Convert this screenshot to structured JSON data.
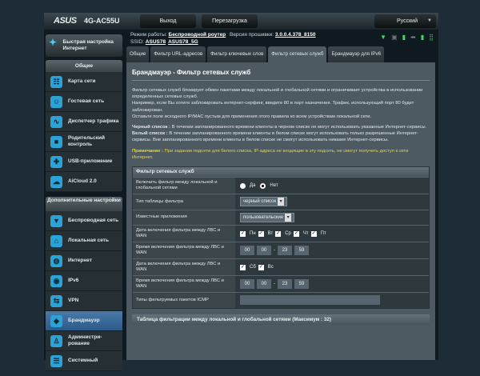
{
  "header": {
    "brand": "ASUS",
    "model": "4G-AC55U",
    "logout": "Выход",
    "reboot": "Перезагрузка",
    "language": "Русский"
  },
  "info": {
    "mode_label": "Режим работы:",
    "mode": "Беспроводной роутер",
    "fw_label": "Версия прошивки:",
    "fw": "3.0.0.4.378_8150",
    "ssid_label": "SSID:",
    "ssid1": "ASUS78",
    "ssid2": "ASUS78_5G"
  },
  "sidebar": {
    "qis": "Быстрая настройка Интернет",
    "general_title": "Общие",
    "general": [
      {
        "label": "Карта сети",
        "icon": "network-map-icon"
      },
      {
        "label": "Гостевая сеть",
        "icon": "guest-network-icon"
      },
      {
        "label": "Диспетчер трафика",
        "icon": "traffic-manager-icon"
      },
      {
        "label": "Родительский контроль",
        "icon": "lock-icon"
      },
      {
        "label": "USB-приложение",
        "icon": "puzzle-icon"
      },
      {
        "label": "AiCloud 2.0",
        "icon": "cloud-icon"
      }
    ],
    "advanced_title": "Дополнительные настройки",
    "advanced": [
      {
        "label": "Беспроводная сеть",
        "icon": "wifi-icon"
      },
      {
        "label": "Локальная сеть",
        "icon": "home-icon"
      },
      {
        "label": "Интернет",
        "icon": "globe-icon"
      },
      {
        "label": "IPv6",
        "icon": "ipv6-icon"
      },
      {
        "label": "VPN",
        "icon": "vpn-icon"
      },
      {
        "label": "Брандмауэр",
        "icon": "shield-icon"
      },
      {
        "label": "Администри-рование",
        "icon": "admin-icon"
      },
      {
        "label": "Системный",
        "icon": "log-icon"
      }
    ]
  },
  "tabs": [
    "Общие",
    "Фильтр URL-адресов",
    "Фильтр ключевых слов",
    "Фильтр сетевых служб",
    "Брандмауэр для IPv6"
  ],
  "content": {
    "title": "Брандмауэр - Фильтр сетевых служб",
    "p1": "Фильтр сетевых служб блокирует обмен пакетами между локальной и глобальной сетями и ограничивает устройства в использовании определенных сетевых служб.",
    "p2": "Например, если Вы хотите заблокировать интернет-серфинг, введите 80 в порт назначения. Трафик, использующий порт 80 будет заблокирован.",
    "p3": "Оставьте поле исходного IP/MAC пустым для применения этого правила ко всем устройствам локальной сети.",
    "black_label": "Черный список :",
    "black": " В течении запланированного времени клиенты в черном списке не могут использовать указанные Интернет-сервисы.",
    "white_label": "Белый список :",
    "white": " В течении запланированного времени клиенты в белом списке могут использовать только разрешенные Интернет-сервисы. Вне запланированного времени клиенты в белом списке не смогут использовать никакие Интернет-сервисы.",
    "note_label": "Примечание :",
    "note": " При задании подсети для белого списка, IP-адреса не входящие в эту подсеть, не смогут получить доступ к сети Интернет."
  },
  "table": {
    "title": "Фильтр сетевых служб",
    "enable_label": "Включить фильтр между локальной и глобальной сетями",
    "yes": "Да",
    "no": "Нет",
    "type_label": "Тип таблицы фильтра",
    "type_value": "черный список",
    "apps_label": "Известные приложения",
    "apps_value": "пользовательские",
    "date1_label": "Дата включения фильтра между ЛВС и WAN",
    "days1": [
      "Пн",
      "Вт",
      "Ср",
      "Чт",
      "Пт"
    ],
    "time1_label": "Время включения фильтра между ЛВС и WAN",
    "time1": [
      "00",
      "00",
      "23",
      "59"
    ],
    "date2_label": "Дата включения фильтра между ЛВС и WAN",
    "days2": [
      "Сб",
      "Вс"
    ],
    "time2_label": "Время включения фильтра между ЛВС и WAN",
    "time2": [
      "00",
      "00",
      "23",
      "59"
    ],
    "icmp_label": "Типы фильтруемых пакетов ICMP",
    "icmp_value": ""
  },
  "table2_title": "Таблица фильтрации между локальной и глобальной сетями (Максимум : 32)"
}
